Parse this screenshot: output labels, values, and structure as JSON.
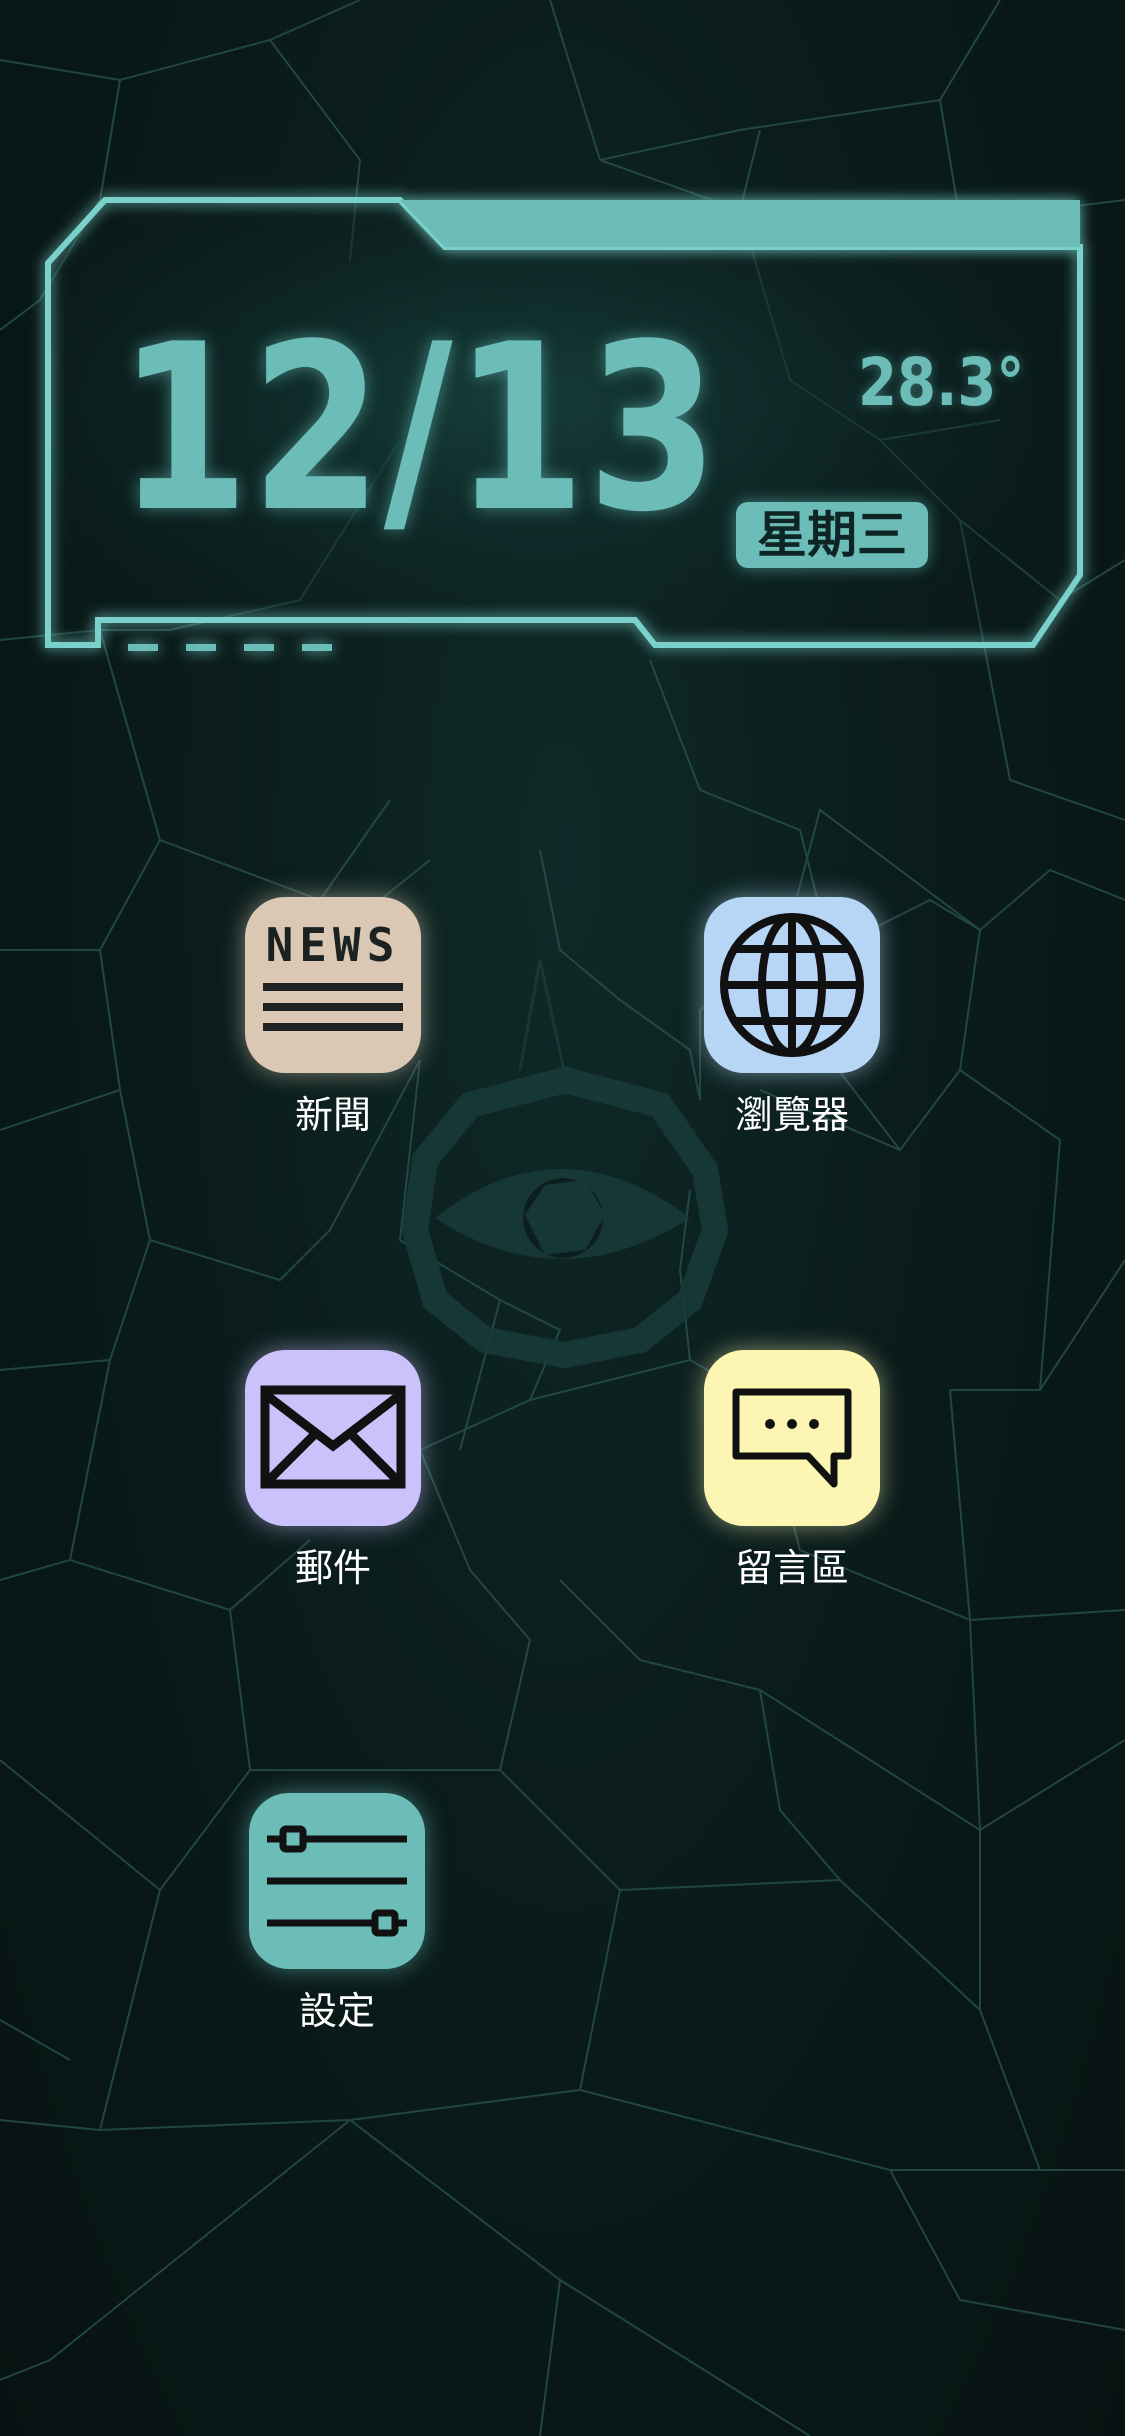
{
  "widget": {
    "date": "12/13",
    "temperature": "28.3°",
    "weekday": "星期三"
  },
  "apps": [
    {
      "label": "新聞",
      "icon": "news-icon",
      "icon_text": "NEWS",
      "color": "#dbc8b4"
    },
    {
      "label": "瀏覽器",
      "icon": "globe-icon",
      "color": "#b7d6f5"
    },
    {
      "label": "郵件",
      "icon": "envelope-icon",
      "color": "#cbc2fb"
    },
    {
      "label": "留言區",
      "icon": "chat-bubble-icon",
      "color": "#fdf6b3"
    },
    {
      "label": "設定",
      "icon": "sliders-icon",
      "color": "#6cbcb7"
    }
  ],
  "theme": {
    "accent": "#6cbcb7",
    "background": "#0a1c1b"
  },
  "wallpaper": {
    "center_icon": "eye-emblem-icon"
  }
}
